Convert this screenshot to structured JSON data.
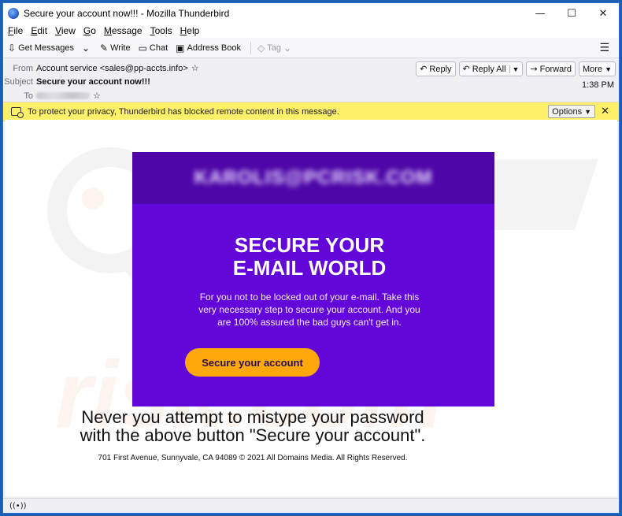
{
  "window": {
    "title": "Secure your account now!!! - Mozilla Thunderbird",
    "controls": {
      "minimize": "—",
      "maximize": "☐",
      "close": "✕"
    }
  },
  "menubar": [
    "File",
    "Edit",
    "View",
    "Go",
    "Message",
    "Tools",
    "Help"
  ],
  "toolbar": {
    "get_messages": "Get Messages",
    "write": "Write",
    "chat": "Chat",
    "address_book": "Address Book",
    "tag": "Tag"
  },
  "header": {
    "from_label": "From",
    "from_value": "Account service <sales@pp-accts.info>",
    "subject_label": "Subject",
    "subject_value": "Secure your account now!!!",
    "to_label": "To",
    "time": "1:38 PM",
    "reply": "Reply",
    "reply_all": "Reply All",
    "forward": "Forward",
    "more": "More"
  },
  "notice": {
    "text": "To protect your privacy, Thunderbird has blocked remote content in this message.",
    "options": "Options"
  },
  "email": {
    "masked_address": "KAROLIS@PCRISK.COM",
    "headline_1": "SECURE YOUR",
    "headline_2": "E-MAIL WORLD",
    "body": "For you not to be locked out of your e-mail. Take this very necessary step to secure your account. And you are 100% assured the bad guys can't get in.",
    "cta": "Secure your account",
    "warning_1": "Never you attempt to mistype your password",
    "warning_2": "with the above button \"Secure your account\".",
    "footer": "701 First Avenue, Sunnyvale, CA 94089 © 2021 All Domains Media. All Rights Reserved."
  },
  "icons": {
    "get_messages": "download-icon",
    "write": "pencil-icon",
    "chat": "chat-bubble-icon",
    "address_book": "address-book-icon",
    "tag": "tag-icon",
    "reply": "reply-icon",
    "reply_all": "reply-all-icon",
    "forward": "forward-icon",
    "status": "wireless-icon"
  },
  "colors": {
    "email_bg": "#6206d9",
    "email_header": "#4e06a8",
    "cta_bg": "#ffa80a",
    "notice_bg": "#fff069",
    "window_accent": "#1a5fb4"
  }
}
